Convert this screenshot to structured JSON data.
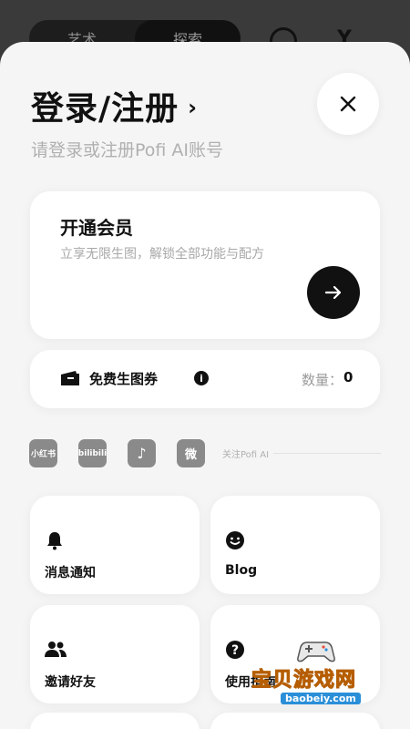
{
  "background": {
    "segments": [
      "艺术",
      "探索"
    ],
    "active_segment": "探索"
  },
  "header": {
    "title": "登录/注册",
    "chevron": "›",
    "subtitle": "请登录或注册Pofi AI账号"
  },
  "vip": {
    "title": "开通会员",
    "description": "立享无限生图，解锁全部功能与配方"
  },
  "coupon": {
    "label": "免费生图券",
    "info_glyph": "i",
    "count_label": "数量：",
    "count_value": "0"
  },
  "social": {
    "icons": [
      {
        "name": "xiaohongshu-icon",
        "text": "小红书"
      },
      {
        "name": "bilibili-icon",
        "text": "bilibili"
      },
      {
        "name": "tiktok-icon",
        "text": "♪"
      },
      {
        "name": "weibo-icon",
        "text": "微"
      }
    ],
    "follow_text": "关注Pofi AI"
  },
  "tiles": {
    "messages": "消息通知",
    "blog": "Blog",
    "invite": "邀请好友",
    "guide": "使用指南"
  },
  "watermark": {
    "text": "宝贝游戏网",
    "url": "baobeiy.com"
  }
}
